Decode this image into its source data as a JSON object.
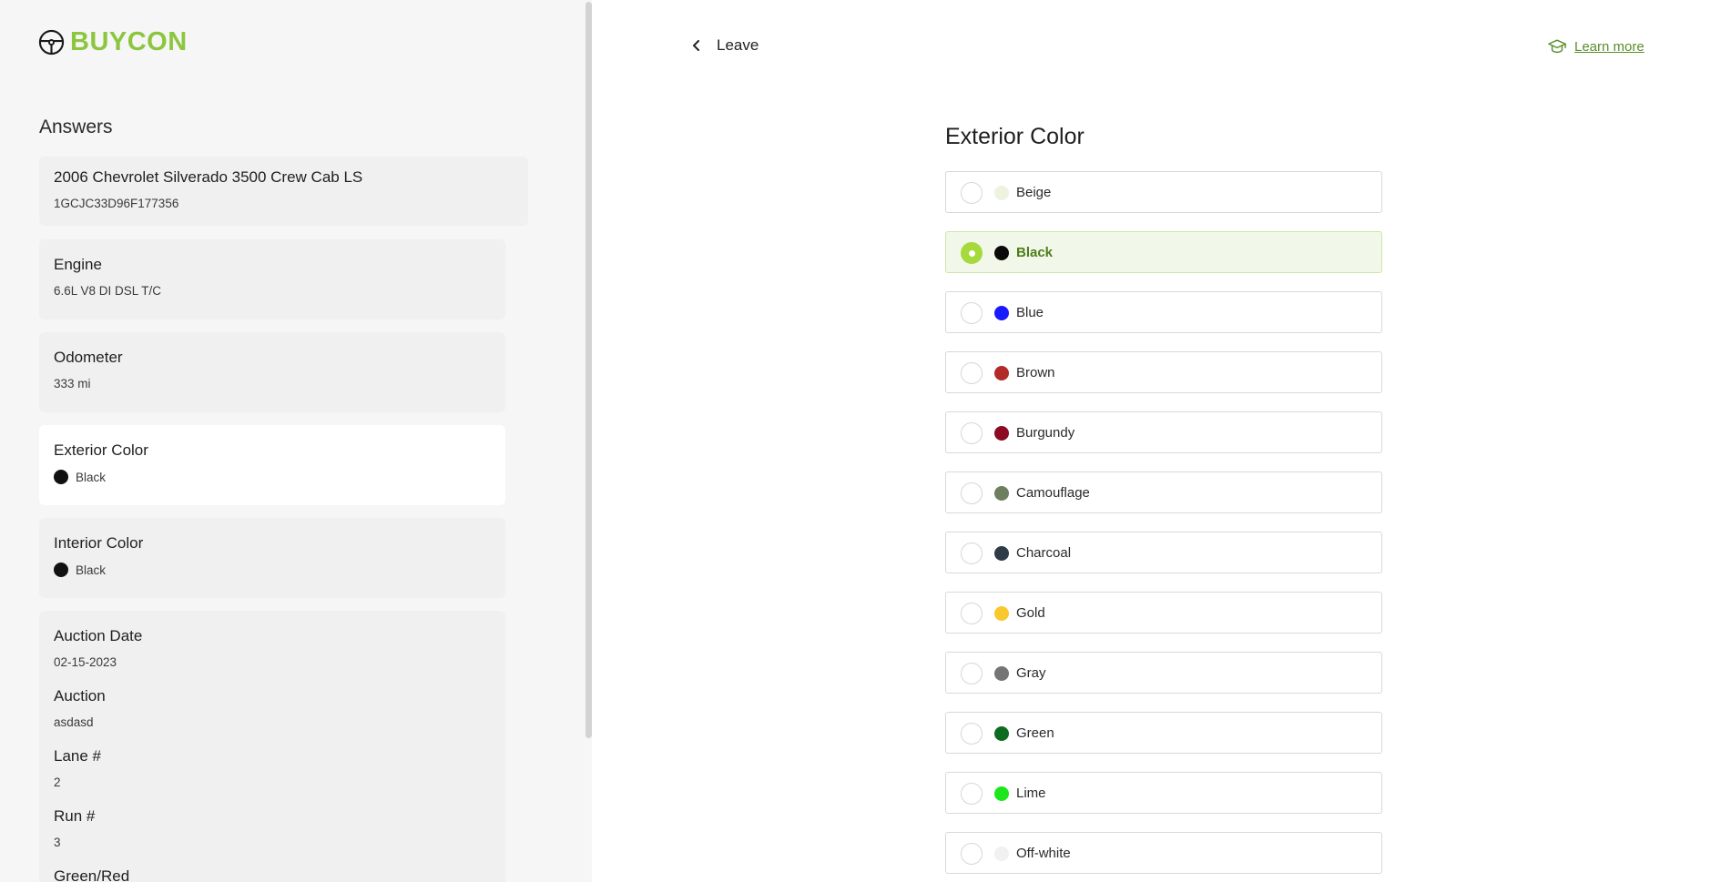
{
  "brand": {
    "name": "BUYCON",
    "icon": "steering-wheel-icon",
    "color": "#8cc63f"
  },
  "sidebar": {
    "title": "Answers",
    "vehicle": {
      "title": "2006 Chevrolet Silverado 3500 Crew Cab LS",
      "vin": "1GCJC33D96F177356"
    },
    "engine": {
      "label": "Engine",
      "value": "6.6L V8 DI DSL T/C"
    },
    "odometer": {
      "label": "Odometer",
      "value": "333 mi"
    },
    "exterior": {
      "label": "Exterior Color",
      "value": "Black",
      "color": "#111111"
    },
    "interior": {
      "label": "Interior Color",
      "value": "Black",
      "color": "#111111"
    },
    "auction_details": [
      {
        "label": "Auction Date",
        "value": "02-15-2023"
      },
      {
        "label": "Auction",
        "value": "asdasd"
      },
      {
        "label": "Lane #",
        "value": "2"
      },
      {
        "label": "Run #",
        "value": "3"
      },
      {
        "label": "Green/Red",
        "value": ""
      }
    ]
  },
  "header": {
    "leave_label": "Leave",
    "leave_icon": "chevron-left-icon",
    "learn_label": "Learn more",
    "learn_icon": "graduation-cap-icon"
  },
  "question": {
    "title": "Exterior Color",
    "selected": "Black",
    "options": [
      {
        "label": "Beige",
        "color": "#eef3df"
      },
      {
        "label": "Black",
        "color": "#0a0a0a"
      },
      {
        "label": "Blue",
        "color": "#1a1aff"
      },
      {
        "label": "Brown",
        "color": "#b22a2a"
      },
      {
        "label": "Burgundy",
        "color": "#8c0a23"
      },
      {
        "label": "Camouflage",
        "color": "#6e7f5f"
      },
      {
        "label": "Charcoal",
        "color": "#2f3b47"
      },
      {
        "label": "Gold",
        "color": "#f8c82c"
      },
      {
        "label": "Gray",
        "color": "#757575"
      },
      {
        "label": "Green",
        "color": "#0d6b1f"
      },
      {
        "label": "Lime",
        "color": "#1de61d"
      },
      {
        "label": "Off-white",
        "color": "#f1f1f1"
      }
    ]
  }
}
